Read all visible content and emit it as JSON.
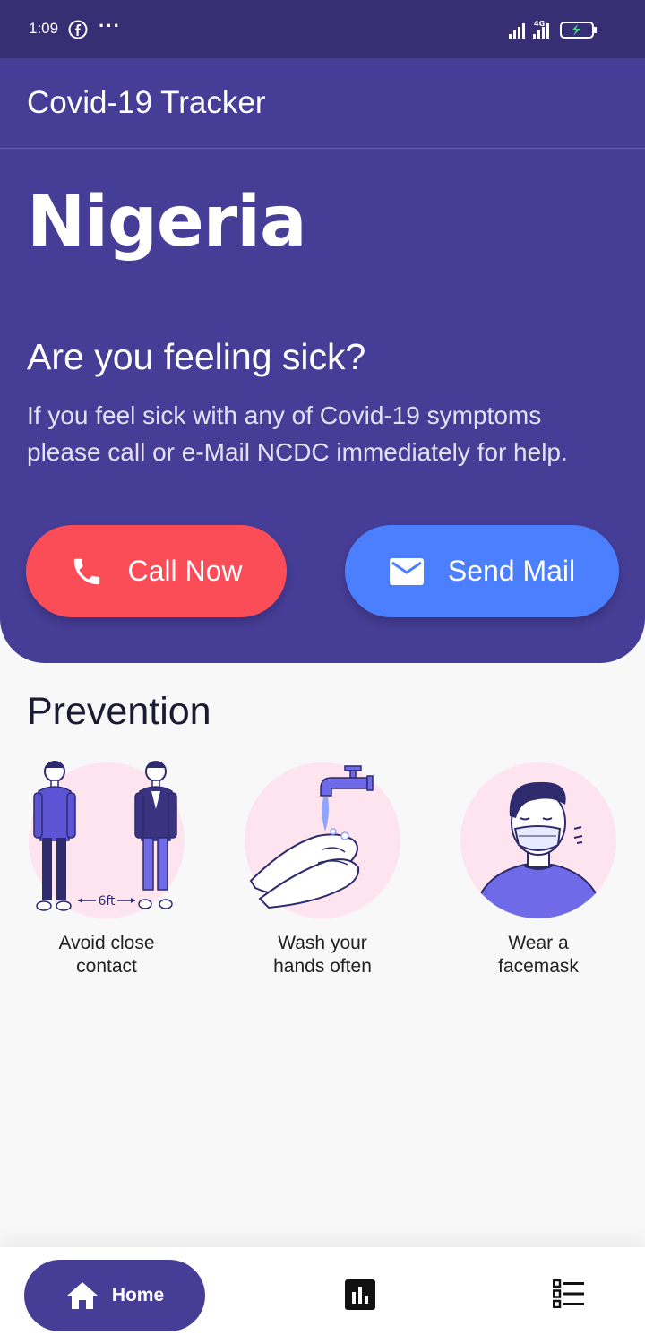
{
  "status_bar": {
    "time": "1:09",
    "icons": [
      "facebook-icon",
      "more-dots-icon",
      "signal-icon",
      "4g-signal-icon",
      "battery-charging-icon"
    ]
  },
  "header": {
    "app_title": "Covid-19 Tracker",
    "country": "Nigeria",
    "sick_title": "Are you feeling sick?",
    "sick_description": "If you feel sick with any of Covid-19 symptoms please call or e-Mail NCDC immediately for help.",
    "call_button": {
      "label": "Call Now",
      "icon": "phone-icon",
      "color": "#fb4d58"
    },
    "mail_button": {
      "label": "Send Mail",
      "icon": "mail-icon",
      "color": "#4c7ffe"
    },
    "color": "#463d96"
  },
  "prevention": {
    "title": "Prevention",
    "items": [
      {
        "label_line1": "Avoid close",
        "label_line2": "contact",
        "icon": "social-distance-illustration",
        "distance_text": "6ft"
      },
      {
        "label_line1": "Wash your",
        "label_line2": "hands often",
        "icon": "hand-washing-illustration"
      },
      {
        "label_line1": "Wear a",
        "label_line2": "facemask",
        "icon": "facemask-illustration"
      }
    ]
  },
  "bottom_nav": {
    "home_label": "Home",
    "items": [
      "home-icon",
      "stats-icon",
      "list-icon"
    ],
    "active": "Home"
  }
}
